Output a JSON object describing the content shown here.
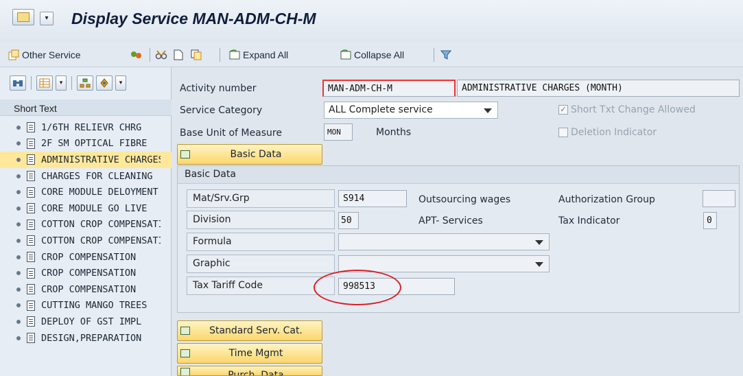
{
  "titlebar": {
    "title": "Display Service MAN-ADM-CH-M"
  },
  "toolbar": {
    "other_service": "Other Service",
    "expand_all": "Expand All",
    "collapse_all": "Collapse All"
  },
  "tree": {
    "header": "Short Text",
    "items": [
      "1/6TH RELIEVR CHRG",
      "2F SM OPTICAL FIBRE",
      "ADMINISTRATIVE CHARGES",
      "CHARGES FOR CLEANING",
      "CORE MODULE DELOYMENT",
      "CORE MODULE GO LIVE",
      "COTTON CROP COMPENSATION",
      "COTTON CROP COMPENSATION",
      "CROP COMPENSATION",
      "CROP COMPENSATION",
      "CROP COMPENSATION",
      "CUTTING MANGO TREES",
      "DEPLOY OF GST IMPL",
      "DESIGN,PREPARATION"
    ]
  },
  "header": {
    "activity_number_label": "Activity number",
    "activity_number": "MAN-ADM-CH-M",
    "activity_text": "ADMINISTRATIVE CHARGES (MONTH)",
    "service_category_label": "Service Category",
    "service_category": "ALL Complete service",
    "short_txt_change_label": "Short Txt Change Allowed",
    "base_uom_label": "Base Unit of Measure",
    "base_uom": "MON",
    "base_uom_text": "Months",
    "deletion_indicator_label": "Deletion Indicator",
    "basic_data_button": "Basic Data"
  },
  "basic_data": {
    "group_title": "Basic Data",
    "mat_srv_grp_label": "Mat/Srv.Grp",
    "mat_srv_grp": "S914",
    "mat_srv_grp_text": "Outsourcing wages",
    "authorization_group_label": "Authorization Group",
    "authorization_group": "",
    "division_label": "Division",
    "division": "50",
    "division_text": "APT- Services",
    "tax_indicator_label": "Tax Indicator",
    "tax_indicator": "0",
    "formula_label": "Formula",
    "formula": "",
    "graphic_label": "Graphic",
    "graphic": "",
    "tax_tariff_code_label": "Tax Tariff Code",
    "tax_tariff_code": "998513"
  },
  "buttons": {
    "standard_serv_cat": "Standard Serv. Cat.",
    "time_mgmt": "Time Mgmt",
    "purch_data": "Purch. Data"
  },
  "colors": {
    "highlight": "#ffe89a",
    "annotation_red": "#d8222a",
    "button_yellow": "#fbd66b"
  }
}
